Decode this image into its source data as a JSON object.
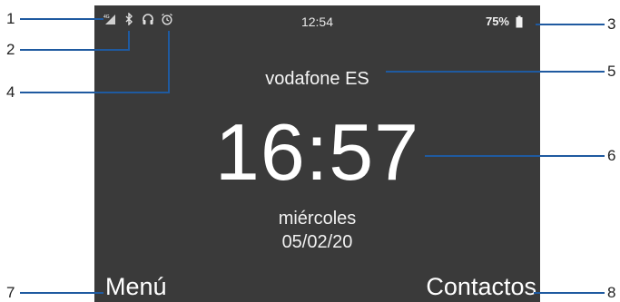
{
  "status_bar": {
    "time": "12:54",
    "battery_percent": "75%",
    "icons": [
      "signal-icon",
      "bluetooth-icon",
      "headphones-icon",
      "alarm-icon",
      "battery-icon"
    ]
  },
  "lock_screen": {
    "carrier": "vodafone ES",
    "clock": "16:57",
    "weekday": "miércoles",
    "date": "05/02/20"
  },
  "softkeys": {
    "left": "Menú",
    "right": "Contactos"
  },
  "callouts": {
    "n1": "1",
    "n2": "2",
    "n3": "3",
    "n4": "4",
    "n5": "5",
    "n6": "6",
    "n7": "7",
    "n8": "8"
  },
  "colors": {
    "screen_bg": "#3a3a3a",
    "callout_line": "#1f5aa0"
  }
}
